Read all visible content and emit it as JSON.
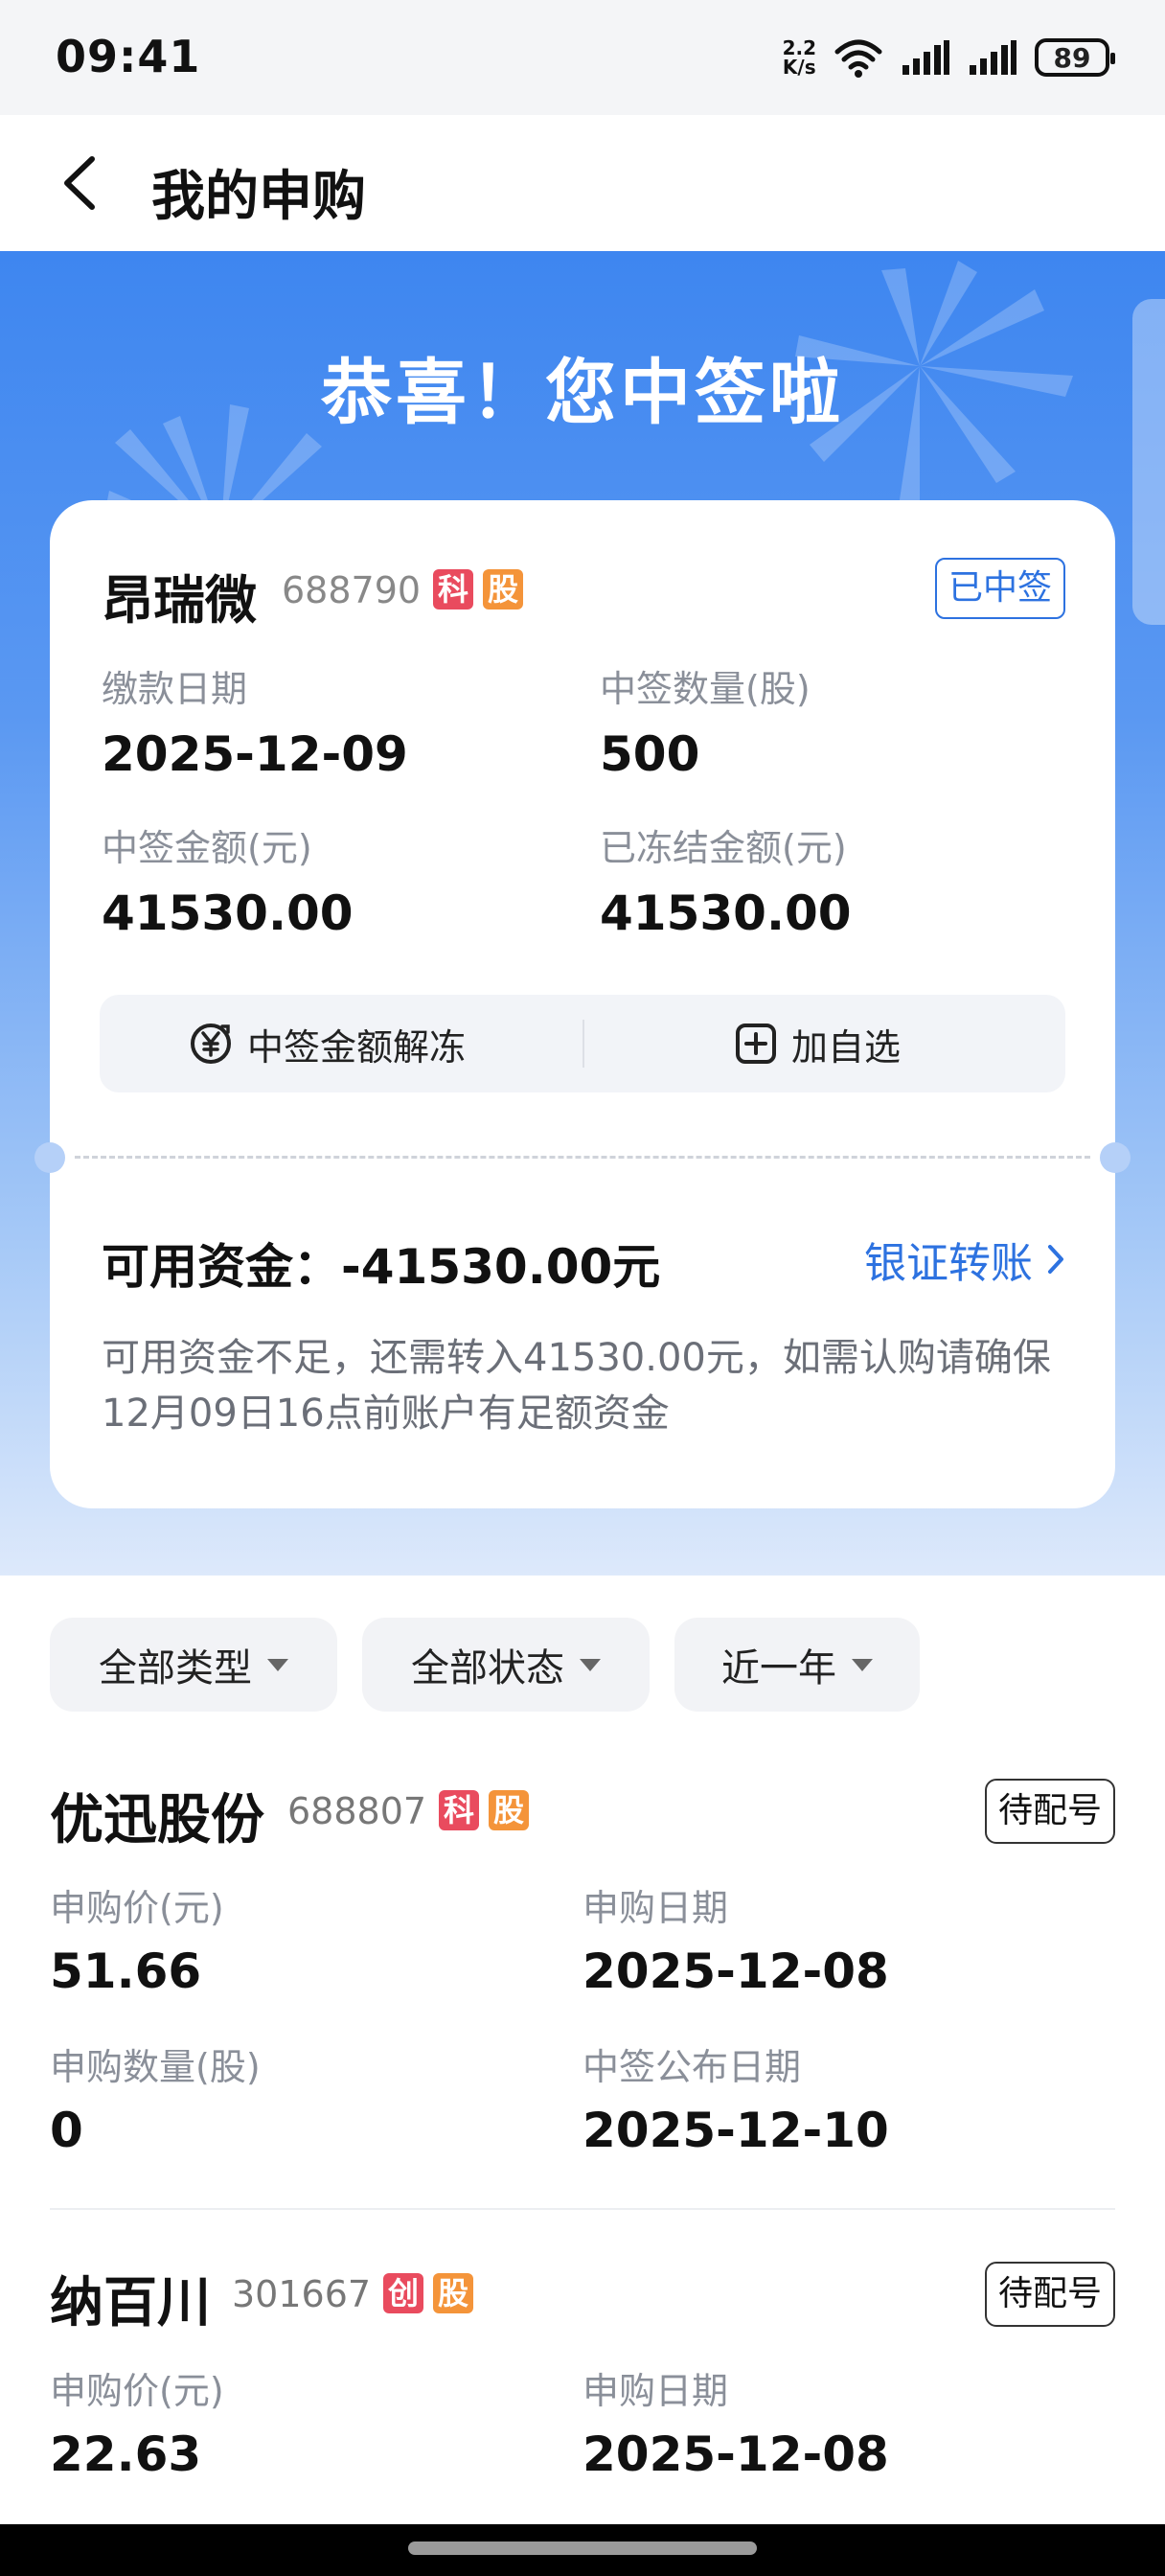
{
  "status_bar": {
    "time": "09:41",
    "net_speed_value": "2.2",
    "net_speed_unit": "K/s",
    "battery": "89"
  },
  "header": {
    "title": "我的申购"
  },
  "banner": {
    "headline": "恭喜！您中签啦"
  },
  "win_card": {
    "name": "昂瑞微",
    "code": "688790",
    "tags": [
      "科",
      "股"
    ],
    "status": "已中签",
    "fields": [
      {
        "label": "缴款日期",
        "value": "2025-12-09"
      },
      {
        "label": "中签数量(股)",
        "value": "500"
      },
      {
        "label": "中签金额(元)",
        "value": "41530.00"
      },
      {
        "label": "已冻结金额(元)",
        "value": "41530.00"
      }
    ],
    "actions": {
      "unfreeze": "中签金额解冻",
      "add_watch": "加自选"
    },
    "available_funds": "可用资金：-41530.00元",
    "transfer_link": "银证转账",
    "notice": "可用资金不足，还需转入41530.00元，如需认购请确保12月09日16点前账户有足额资金"
  },
  "filters": [
    "全部类型",
    "全部状态",
    "近一年"
  ],
  "ipo_list": [
    {
      "name": "优迅股份",
      "code": "688807",
      "tags": [
        "科",
        "股"
      ],
      "status": "待配号",
      "fields": [
        {
          "label": "申购价(元)",
          "value": "51.66"
        },
        {
          "label": "申购日期",
          "value": "2025-12-08"
        },
        {
          "label": "申购数量(股)",
          "value": "0"
        },
        {
          "label": "中签公布日期",
          "value": "2025-12-10"
        }
      ]
    },
    {
      "name": "纳百川",
      "code": "301667",
      "tags": [
        "创",
        "股"
      ],
      "status": "待配号",
      "fields": [
        {
          "label": "申购价(元)",
          "value": "22.63"
        },
        {
          "label": "申购日期",
          "value": "2025-12-08"
        }
      ]
    }
  ]
}
